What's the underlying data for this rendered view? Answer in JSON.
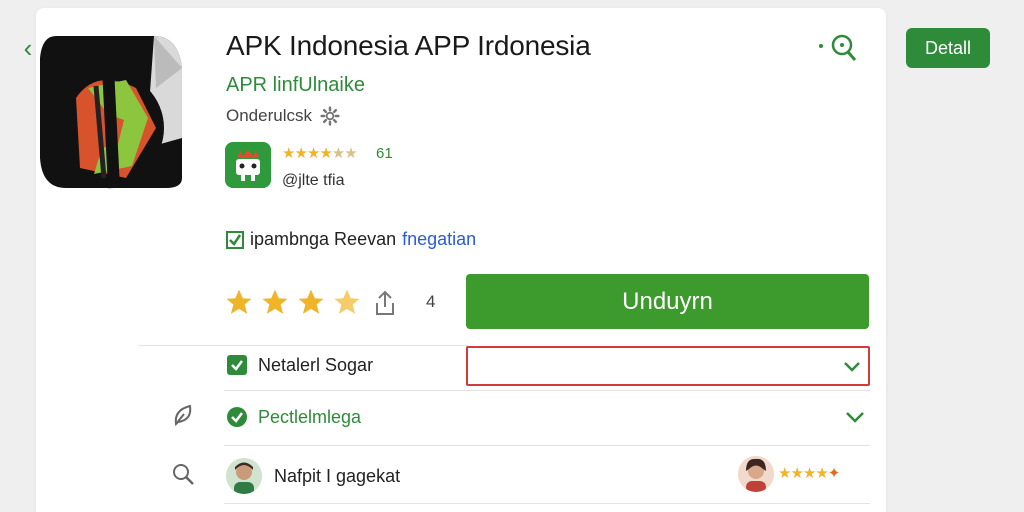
{
  "colors": {
    "accent": "#2e8b3a",
    "button": "#3d9a2c",
    "star": "#f0b429",
    "highlight_border": "#d23b3b",
    "link": "#2a5bd7"
  },
  "header": {
    "title": "APK Indonesia APP Irdonesia",
    "developer": "APR linfUlnaike",
    "category": "Onderulcsk",
    "detail_label": "Detall"
  },
  "sub_app": {
    "rating": "61",
    "handle": "@jlte tfia"
  },
  "feature": {
    "text": "ipambnga Reevan",
    "link": "fnegatian"
  },
  "rating": {
    "stars": 3.5,
    "count": "4"
  },
  "download": {
    "label": "Unduyrn"
  },
  "rows": [
    {
      "label": "Netalerl Sogar"
    },
    {
      "label": "Pectlelmlega"
    },
    {
      "label": "Nafpit I gagekat"
    }
  ],
  "icons": [
    "back-arrow-icon",
    "search-icon",
    "gear-icon",
    "share-icon",
    "check-icon",
    "chevron-down-icon",
    "leaf-icon",
    "magnifier-icon"
  ]
}
